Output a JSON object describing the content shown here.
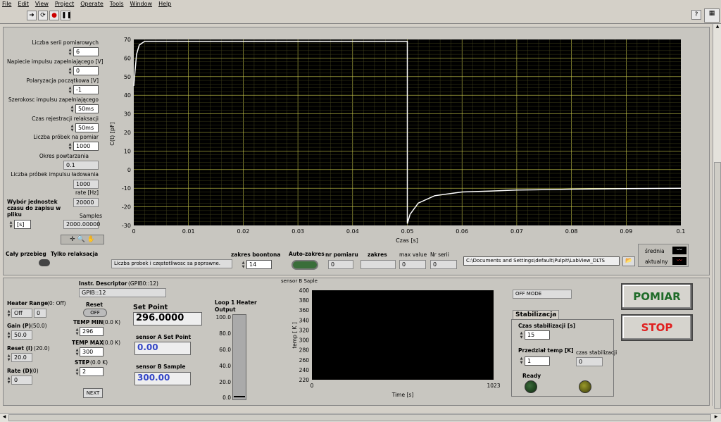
{
  "menu": [
    "File",
    "Edit",
    "View",
    "Project",
    "Operate",
    "Tools",
    "Window",
    "Help"
  ],
  "left": {
    "liczba_serii_label": "Liczba serii pomiarowych",
    "liczba_serii": "6",
    "napiecie_label": "Napiecie impulsu zapełniającego [V]",
    "napiecie": "0",
    "polaryzacja_label": "Polaryzacja początkowa [V]",
    "polaryzacja": "-1",
    "szerokosc_label": "Szerokosc  impulsu zapełniającego",
    "szerokosc": "50ms",
    "czas_label": "Czas rejestracji relaksacji",
    "czas": "50ms",
    "liczba_probek_label": "Liczba próbek na pomiar",
    "liczba_probek": "1000",
    "okres_label": "Okres powtarzania",
    "okres": "0.1",
    "probek_impulsu_label": "Liczba próbek impulsu ładowania",
    "probek_impulsu": "1000",
    "rate_label": "rate [Hz]",
    "rate": "20000",
    "wybor_label": "Wybór jednostek czasu do zapisu w pliku",
    "samples_label": "Samples",
    "jednostka": "[s]",
    "samples": "2000.00000"
  },
  "mode": {
    "caly": "Cały przebieg",
    "tylko": "Tylko relaksacja",
    "info": "Liczba probek i częstotliwosc sa poprawne."
  },
  "controls": {
    "zakres_boontona_label": "zakres boontona",
    "zakres_boontona": "14",
    "auto_zakres_label": "Auto-zakres",
    "nr_pomiaru_label": "nr pomiaru",
    "nr_pomiaru": "0",
    "zakres_label": "zakres",
    "max_value_label": "max value",
    "max_value": "0",
    "nr_serii_label": "Nr serii",
    "nr_serii": "0",
    "path": "C:\\Documents and Settings\\default\\Pulpit\\LabView_DLTS",
    "legend_srednia": "średnia",
    "legend_aktualny": "aktualny"
  },
  "chart_data": [
    {
      "type": "line",
      "ylabel": "C(t) [pF]",
      "xlabel": "Czas [s]",
      "xlim": [
        0,
        0.1
      ],
      "ylim": [
        -30,
        70
      ],
      "xticks": [
        "0",
        "0.01",
        "0.02",
        "0.03",
        "0.04",
        "0.05",
        "0.06",
        "0.07",
        "0.08",
        "0.09",
        "0.1"
      ],
      "yticks": [
        "70",
        "60",
        "50",
        "40",
        "30",
        "20",
        "10",
        "0",
        "-10",
        "-20",
        "-30"
      ],
      "grid": true,
      "series": [
        {
          "name": "średnia",
          "color": "#ffffff",
          "x": [
            0,
            0.0005,
            0.001,
            0.002,
            0.004,
            0.008,
            0.05,
            0.05,
            0.0505,
            0.052,
            0.055,
            0.06,
            0.065,
            0.07,
            0.08,
            0.09,
            0.1
          ],
          "y": [
            45,
            62,
            67,
            69,
            69,
            69,
            69,
            -29,
            -24,
            -18,
            -14,
            -12,
            -11.5,
            -11,
            -10.5,
            -10.2,
            -10
          ]
        }
      ]
    },
    {
      "type": "line",
      "title": "sensor B Saple",
      "ylabel": "temp [ K ]",
      "xlabel": "Time [s]",
      "xlim": [
        0,
        1023
      ],
      "ylim": [
        220,
        400
      ],
      "xticks": [
        "0",
        "1023"
      ],
      "yticks": [
        "400",
        "380",
        "360",
        "340",
        "320",
        "300",
        "280",
        "260",
        "240",
        "220"
      ],
      "series": []
    }
  ],
  "heater": {
    "range_label": "Heater Range",
    "range_hint": "(0: Off)",
    "range_val": "Off",
    "range_num": "0",
    "gain_label": "Gain (P)",
    "gain_hint": "(50.0)",
    "gain": "50.0",
    "reset_label": "Reset (I)",
    "reset_hint": "(20.0)",
    "reset": "20.0",
    "rate_label": "Rate (D)",
    "rate_hint": "(0)",
    "rate": "0"
  },
  "instr": {
    "label": "Instr. Descriptor",
    "hint": "(GPIB0::12)",
    "value": "GPIB::12"
  },
  "temp": {
    "reset_label": "Reset",
    "reset_toggle": "OFF",
    "tmin_label": "TEMP MIN",
    "tmin_hint": "(0.0 K)",
    "tmin": "296",
    "tmax_label": "TEMP MAX",
    "tmax_hint": "(0.0 K)",
    "tmax": "300",
    "step_label": "STEP",
    "step_hint": "(0.0 K)",
    "step": "2",
    "next": "NEXT",
    "setpoint_label": "Set Point",
    "setpoint": "296.0000",
    "sa_label": "sensor A Set Point",
    "sa": "0.00",
    "sb_label": "sensor B Sample",
    "sb": "300.00"
  },
  "loop": {
    "title": "Loop 1 Heater Output",
    "ticks": [
      "100.0",
      "80.0",
      "60.0",
      "40.0",
      "20.0",
      "0.0"
    ]
  },
  "right": {
    "off_mode": "OFF MODE",
    "stab_title": "Stabilizacja",
    "czas_stab_label": "Czas stabilizacji [s]",
    "czas_stab": "15",
    "przedzial_label": "Przedział temp  [K]",
    "przedzial": "1",
    "czas_stab2_label": "czas stabilizacji",
    "czas_stab2": "0",
    "ready_label": "Ready",
    "pomiar": "POMIAR",
    "stop": "STOP"
  }
}
